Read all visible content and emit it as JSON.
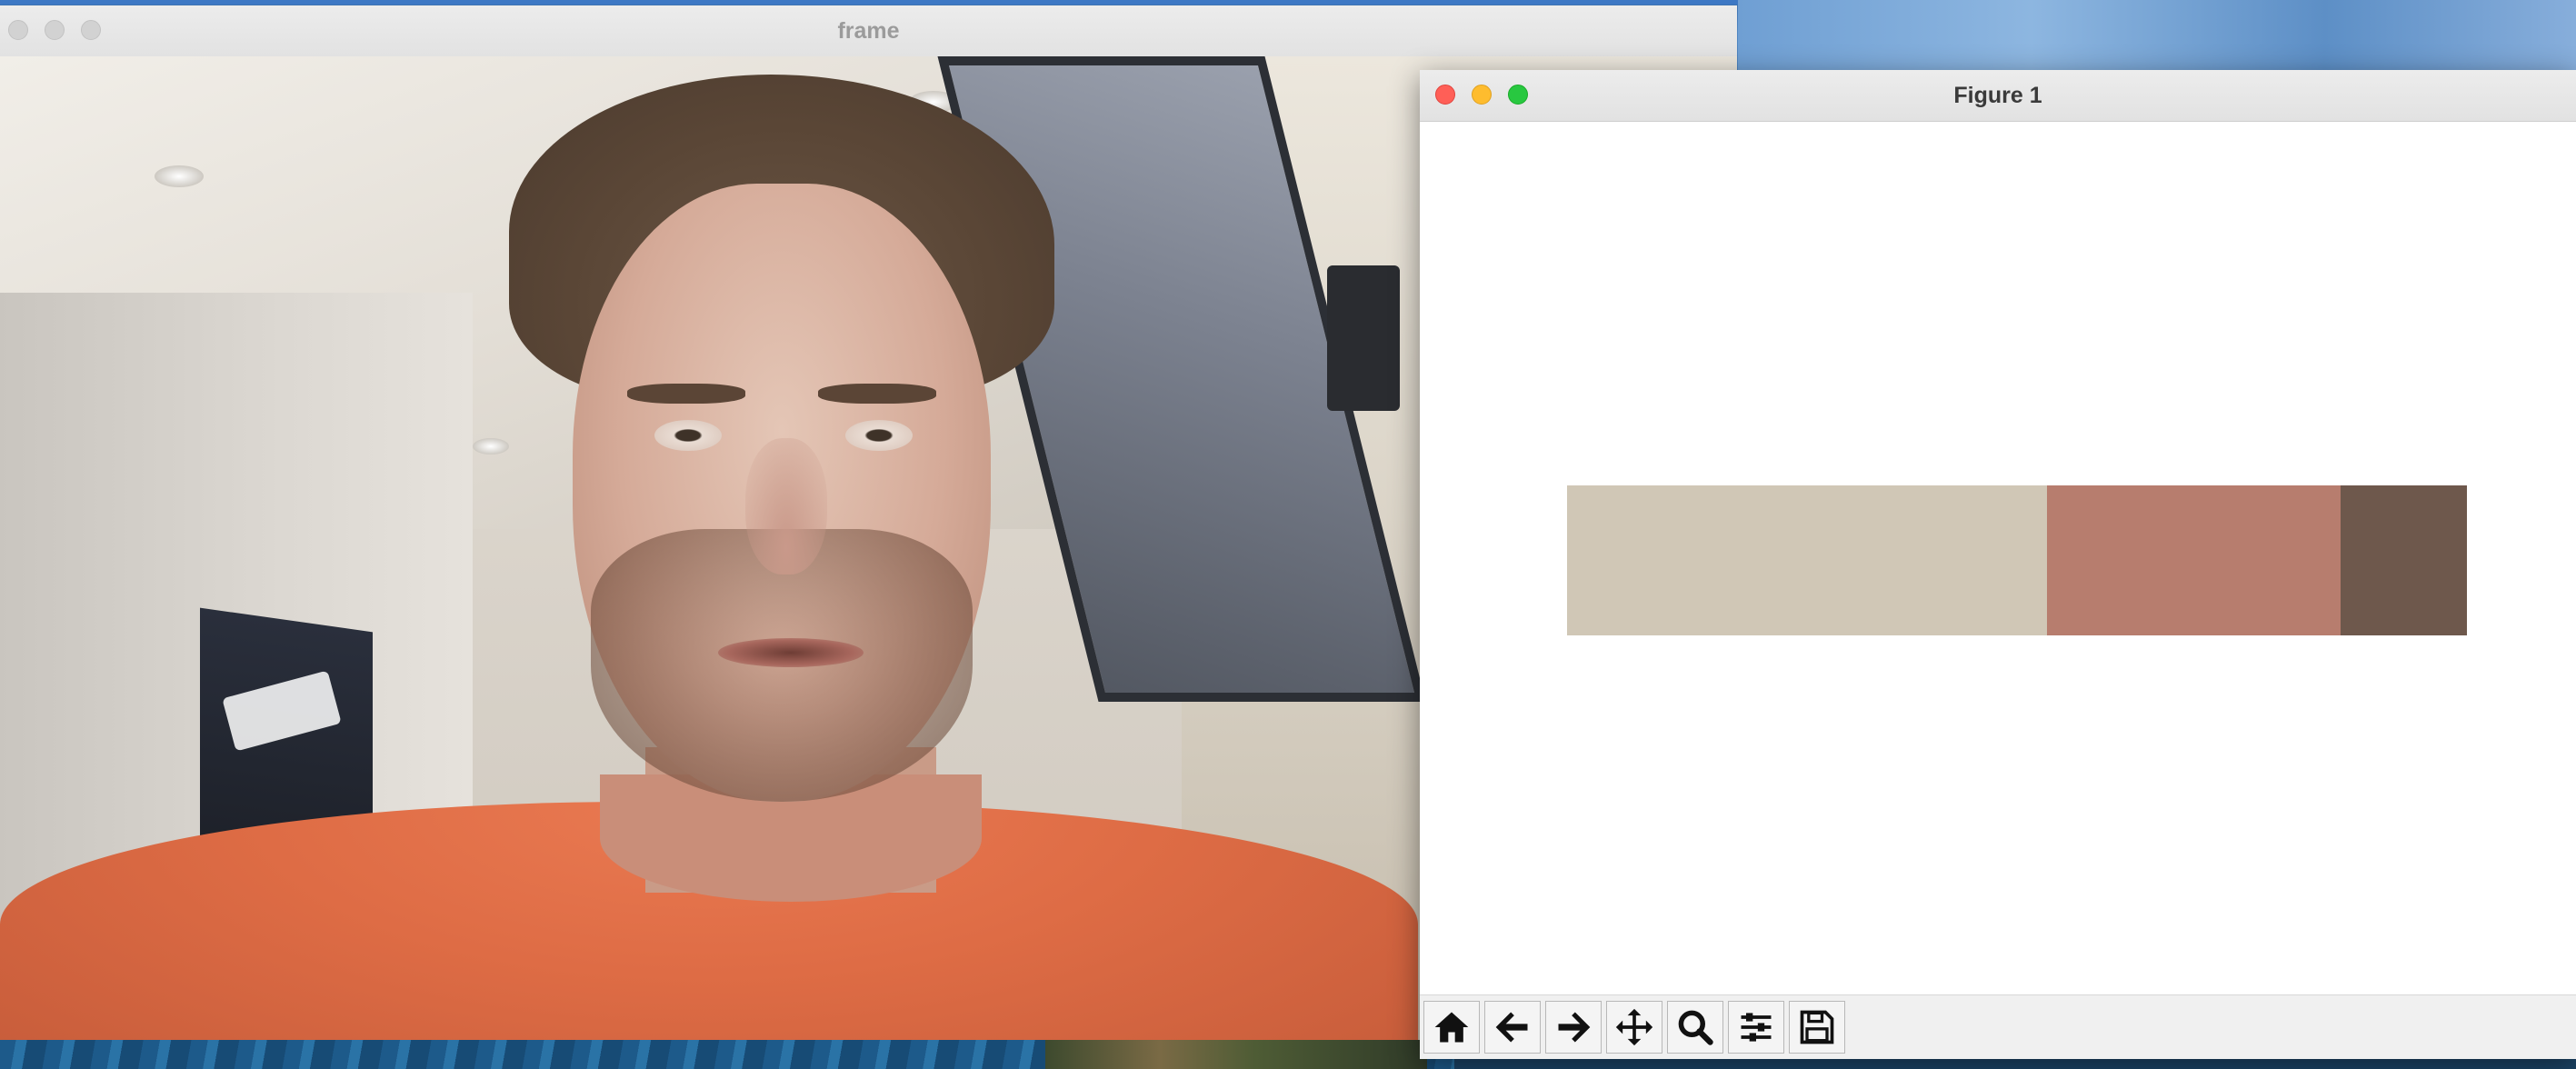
{
  "frame_window": {
    "title": "frame"
  },
  "figure_window": {
    "title": "Figure 1",
    "toolbar": [
      {
        "name": "home-icon"
      },
      {
        "name": "back-arrow-icon"
      },
      {
        "name": "forward-arrow-icon"
      },
      {
        "name": "pan-move-icon"
      },
      {
        "name": "zoom-magnifier-icon"
      },
      {
        "name": "configure-subplots-icon"
      },
      {
        "name": "save-floppy-icon"
      }
    ]
  },
  "chart_data": {
    "type": "bar",
    "orientation": "horizontal-stacked",
    "axes_visible": false,
    "segments": [
      {
        "color": "#d0c7b6",
        "fraction": 0.533
      },
      {
        "color": "#b77d6e",
        "fraction": 0.327
      },
      {
        "color": "#6e584c",
        "fraction": 0.14
      }
    ]
  },
  "colors": {
    "close": "#ff5f57",
    "minimize": "#febc2e",
    "maximize": "#28c840"
  }
}
